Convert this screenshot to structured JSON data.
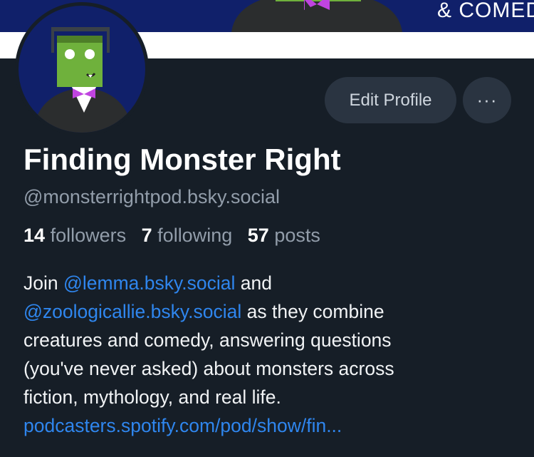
{
  "banner": {
    "text": "& COMED"
  },
  "profile": {
    "display_name": "Finding Monster Right",
    "handle": "@monsterrightpod.bsky.social"
  },
  "actions": {
    "edit_label": "Edit Profile",
    "more_label": "···"
  },
  "stats": {
    "followers_count": "14",
    "followers_label": "followers",
    "following_count": "7",
    "following_label": "following",
    "posts_count": "57",
    "posts_label": "posts"
  },
  "bio": {
    "join": "Join ",
    "mention1": "@lemma.bsky.social",
    "and": " and",
    "mention2": "@zoologicallie.bsky.social",
    "line2_rest": " as they combine",
    "line3": "creatures and comedy, answering questions",
    "line4": "(you've never asked) about monsters across",
    "line5": "fiction, mythology, and real life.",
    "link": "podcasters.spotify.com/pod/show/fin..."
  },
  "colors": {
    "background": "#161e27",
    "banner": "#10206a",
    "link": "#2f86ee",
    "button": "#2a3441"
  },
  "icons": {
    "more": "more-horizontal-icon"
  }
}
